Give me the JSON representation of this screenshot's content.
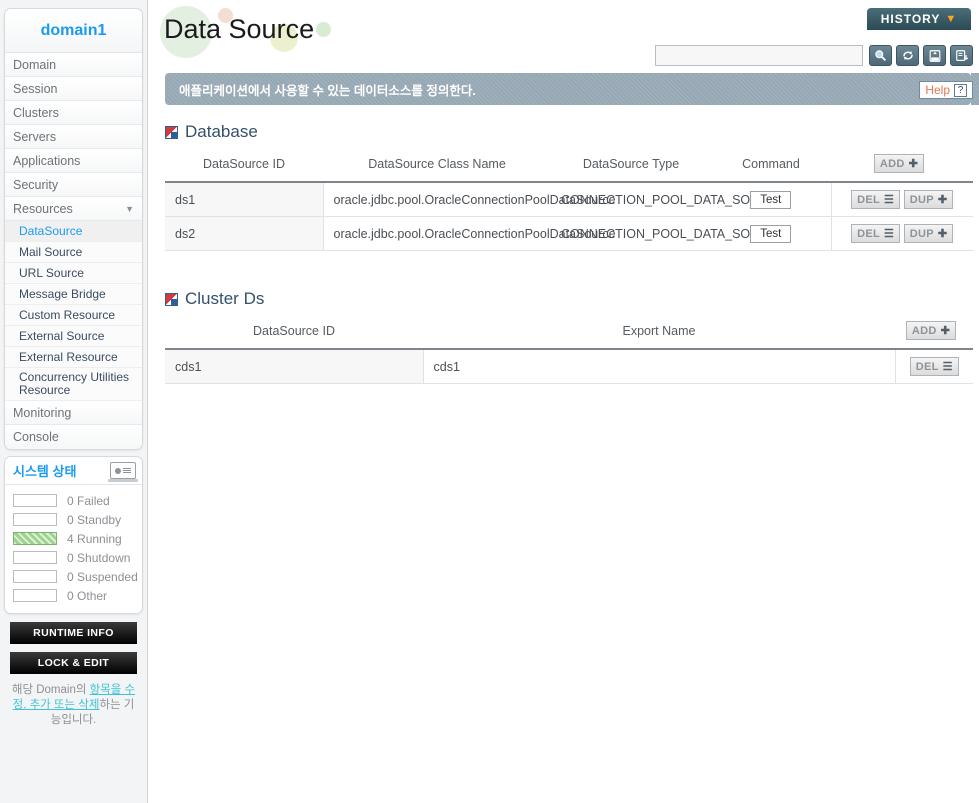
{
  "sidebar": {
    "domain_label": "domain1",
    "nav": [
      {
        "label": "Domain",
        "expandable": false
      },
      {
        "label": "Session",
        "expandable": false
      },
      {
        "label": "Clusters",
        "expandable": false
      },
      {
        "label": "Servers",
        "expandable": false
      },
      {
        "label": "Applications",
        "expandable": false
      },
      {
        "label": "Security",
        "expandable": false
      },
      {
        "label": "Resources",
        "expandable": true
      }
    ],
    "resources_sub": [
      {
        "label": "DataSource",
        "active": true
      },
      {
        "label": "Mail Source",
        "active": false
      },
      {
        "label": "URL Source",
        "active": false
      },
      {
        "label": "Message Bridge",
        "active": false
      },
      {
        "label": "Custom Resource",
        "active": false
      },
      {
        "label": "External Source",
        "active": false
      },
      {
        "label": "External Resource",
        "active": false
      },
      {
        "label": "Concurrency Utilities Resource",
        "active": false
      }
    ],
    "nav_after": [
      {
        "label": "Monitoring"
      },
      {
        "label": "Console"
      }
    ],
    "status": {
      "title": "시스템 상태",
      "icon": "monitor-icon",
      "rows": [
        {
          "count": "0",
          "label": "Failed",
          "filled": false
        },
        {
          "count": "0",
          "label": "Standby",
          "filled": false
        },
        {
          "count": "4",
          "label": "Running",
          "filled": true
        },
        {
          "count": "0",
          "label": "Shutdown",
          "filled": false
        },
        {
          "count": "0",
          "label": "Suspended",
          "filled": false
        },
        {
          "count": "0",
          "label": "Other",
          "filled": false
        }
      ],
      "fill_color": "#9ed38f"
    },
    "runtime_info_label": "RUNTIME INFO",
    "lock_edit_label": "LOCK & EDIT",
    "note_part1": "해당 Domain의 ",
    "note_link": "항목을 수정, 추가 또는 삭제",
    "note_part2": "하는 기능입니다."
  },
  "header": {
    "page_title": "Data Source",
    "history_label": "HISTORY",
    "history_caret": "▼",
    "search_placeholder": "",
    "search_value": "",
    "toolbar_icons": [
      {
        "name": "search-icon",
        "glyph": "⌕"
      },
      {
        "name": "refresh-icon",
        "glyph": "↻"
      },
      {
        "name": "xml-export-icon",
        "glyph": "XML"
      },
      {
        "name": "report-download-icon",
        "glyph": "↓"
      }
    ],
    "description": "애플리케이션에서 사용할 수 있는 데이터소스를 정의한다.",
    "help_label": "Help",
    "help_mark": "?"
  },
  "database_section": {
    "title": "Database",
    "add_label": "ADD",
    "columns": [
      "DataSource ID",
      "DataSource Class Name",
      "DataSource Type",
      "Command"
    ],
    "rows": [
      {
        "id": "ds1",
        "class_name": "oracle.jdbc.pool.OracleConnectionPoolDataSource",
        "type": "CONNECTION_POOL_DATA_SOURCE",
        "command": "Test",
        "del_label": "DEL",
        "dup_label": "DUP"
      },
      {
        "id": "ds2",
        "class_name": "oracle.jdbc.pool.OracleConnectionPoolDataSource",
        "type": "CONNECTION_POOL_DATA_SOURCE",
        "command": "Test",
        "del_label": "DEL",
        "dup_label": "DUP"
      }
    ]
  },
  "cluster_section": {
    "title": "Cluster Ds",
    "add_label": "ADD",
    "columns": [
      "DataSource ID",
      "Export Name"
    ],
    "rows": [
      {
        "id": "cds1",
        "export_name": "cds1",
        "del_label": "DEL"
      }
    ]
  }
}
